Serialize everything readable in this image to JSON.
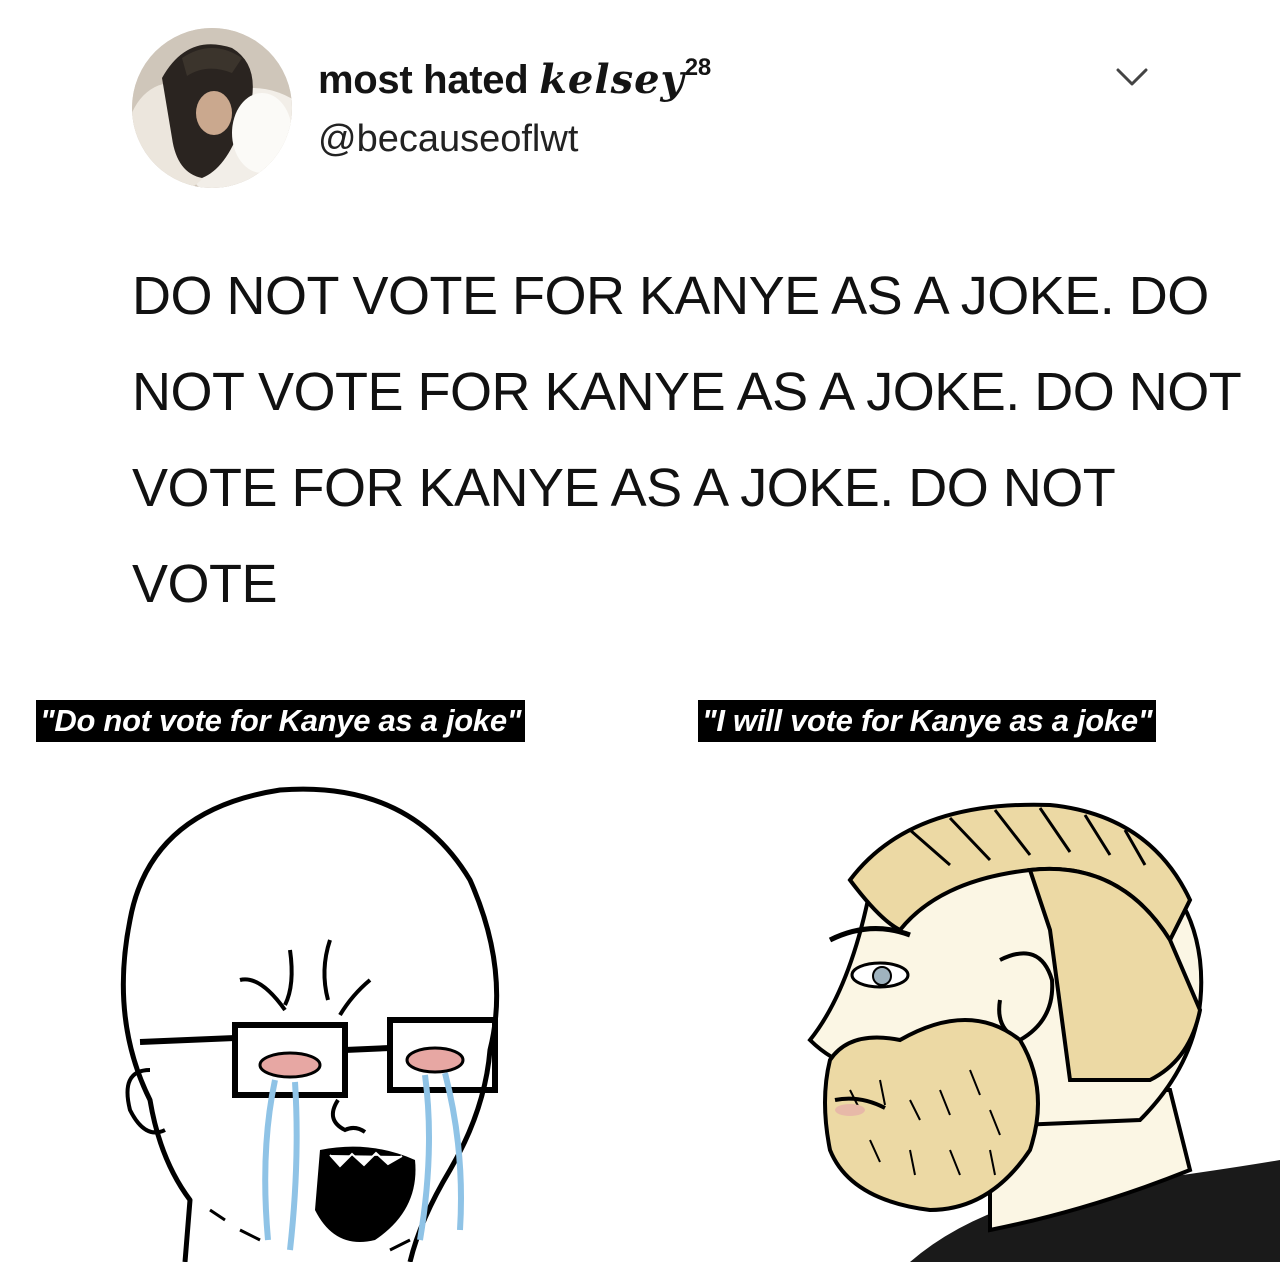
{
  "tweet": {
    "display_name": "most hated",
    "display_name_fancy": "kelsey",
    "display_name_sup": "28",
    "handle": "@becauseoflwt",
    "text": "DO NOT VOTE FOR KANYE AS A JOKE. DO NOT VOTE FOR KANYE AS A JOKE. DO NOT VOTE FOR KANYE AS A JOKE. DO NOT VOTE"
  },
  "meme": {
    "left_caption": "\"Do not vote for Kanye as a joke\"",
    "right_caption": "\"I will vote for Kanye as a joke\""
  },
  "colors": {
    "caption_bg": "#000000",
    "caption_text": "#ffffff",
    "hair": "#ecd9a4",
    "tears": "#8fc3e6"
  }
}
